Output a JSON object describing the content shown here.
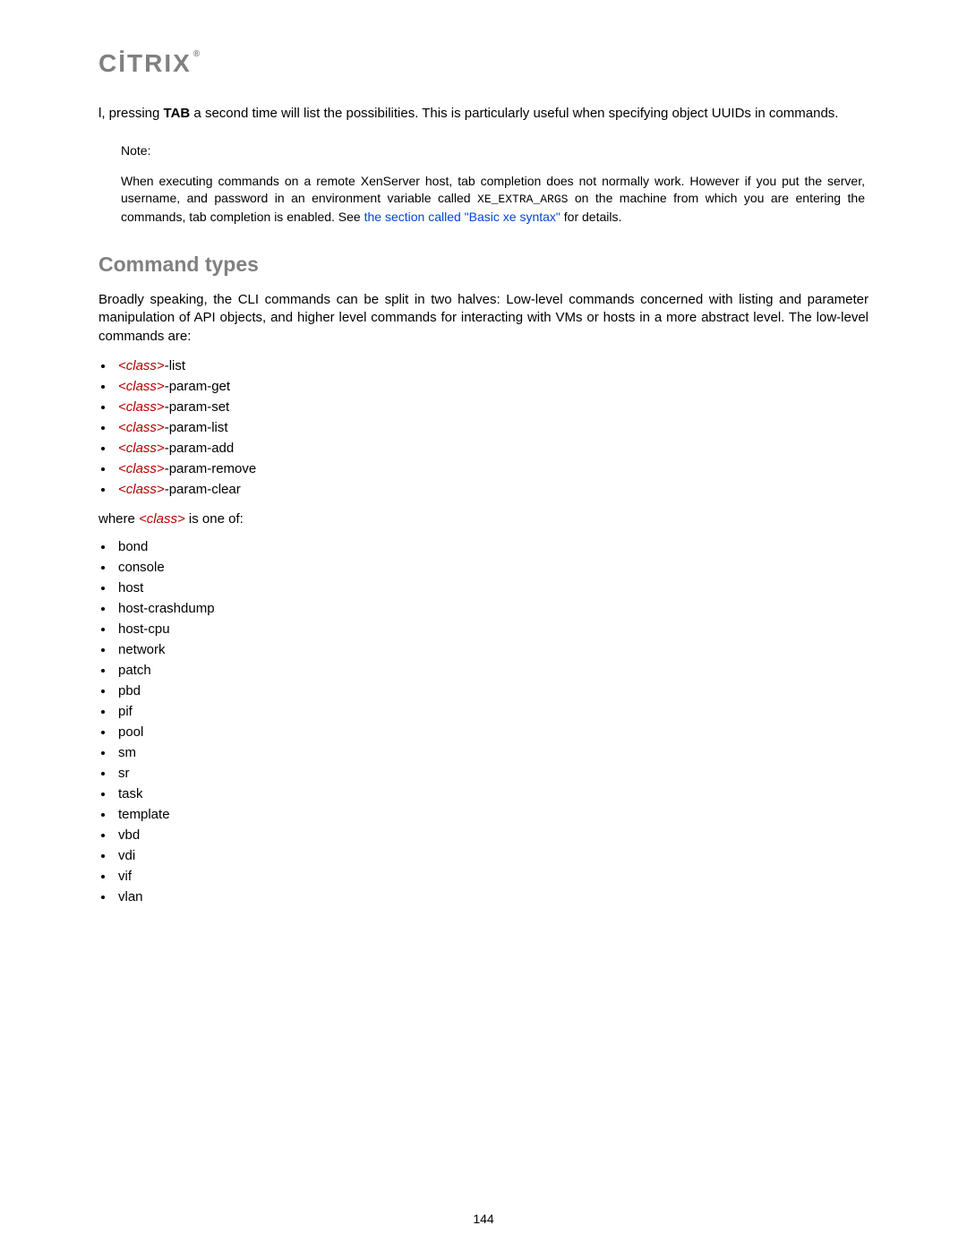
{
  "header": {
    "logo_text": "CİTRIX",
    "logo_reg": "®"
  },
  "intro": {
    "pre_tab": "l, pressing ",
    "tab_key": "TAB",
    "post_tab": " a second time will list the possibilities. This is particularly useful when specifying object UUIDs in commands."
  },
  "note": {
    "label": "Note:",
    "seg1": "When executing commands on a remote XenServer host, tab completion does not normally work. However if you put the server, username, and password in an environment variable called ",
    "code": "XE_EXTRA_ARGS",
    "seg2": " on the machine from which you are entering the commands, tab completion is enabled. See ",
    "link": "the section called \"Basic xe syntax\"",
    "seg3": " for details."
  },
  "section": {
    "heading": "Command types",
    "para": "Broadly speaking, the CLI commands can be split in two halves: Low-level commands concerned with listing and parameter manipulation of API objects, and higher level commands for interacting with VMs or hosts in a more abstract level. The low-level commands are:"
  },
  "commands": [
    {
      "class": "<class>",
      "suffix": "-list"
    },
    {
      "class": "<class>",
      "suffix": "-param-get"
    },
    {
      "class": "<class>",
      "suffix": "-param-set"
    },
    {
      "class": "<class>",
      "suffix": "-param-list"
    },
    {
      "class": "<class>",
      "suffix": "-param-add"
    },
    {
      "class": "<class>",
      "suffix": "-param-remove"
    },
    {
      "class": "<class>",
      "suffix": "-param-clear"
    }
  ],
  "where": {
    "pre": "where ",
    "class": "<class>",
    "post": " is one of:"
  },
  "classes": [
    "bond",
    "console",
    "host",
    "host-crashdump",
    "host-cpu",
    "network",
    "patch",
    "pbd",
    "pif",
    "pool",
    "sm",
    "sr",
    "task",
    "template",
    "vbd",
    "vdi",
    "vif",
    "vlan"
  ],
  "page_number": "144"
}
